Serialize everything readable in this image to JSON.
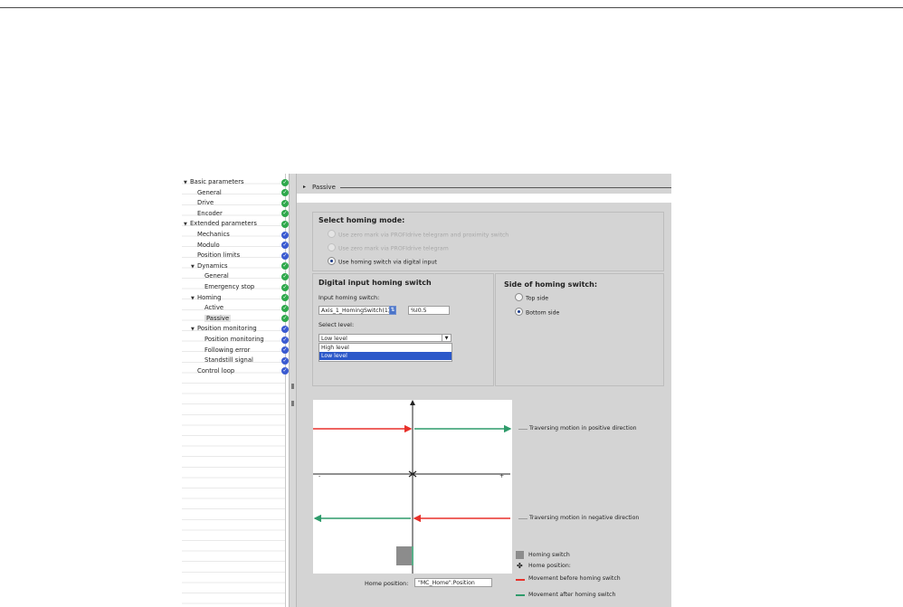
{
  "tree": [
    {
      "label": "Basic parameters",
      "expanded": true,
      "status": "green"
    },
    {
      "label": "General",
      "status": "green"
    },
    {
      "label": "Drive",
      "status": "green"
    },
    {
      "label": "Encoder",
      "status": "green"
    },
    {
      "label": "Extended parameters",
      "expanded": true,
      "status": "green"
    },
    {
      "label": "Mechanics",
      "status": "blue"
    },
    {
      "label": "Modulo",
      "status": "blue"
    },
    {
      "label": "Position limits",
      "status": "blue"
    },
    {
      "label": "Dynamics",
      "expanded": true,
      "status": "green"
    },
    {
      "label": "General",
      "status": "green"
    },
    {
      "label": "Emergency stop",
      "status": "green"
    },
    {
      "label": "Homing",
      "expanded": true,
      "status": "green"
    },
    {
      "label": "Active",
      "status": "green"
    },
    {
      "label": "Passive",
      "status": "green",
      "selected": true
    },
    {
      "label": "Position monitoring",
      "expanded": true,
      "status": "blue"
    },
    {
      "label": "Position monitoring",
      "status": "blue"
    },
    {
      "label": "Following error",
      "status": "blue"
    },
    {
      "label": "Standstill signal",
      "status": "blue"
    },
    {
      "label": "Control loop",
      "status": "blue"
    }
  ],
  "section_title": "Passive",
  "homing_mode": {
    "title": "Select homing mode:",
    "options": [
      {
        "label": "Use zero mark via PROFIdrive telegram and proximity switch",
        "enabled": false,
        "selected": false
      },
      {
        "label": "Use zero mark via PROFIdrive telegram",
        "enabled": false,
        "selected": false
      },
      {
        "label": "Use homing switch via digital input",
        "enabled": true,
        "selected": true
      }
    ]
  },
  "digital_input": {
    "title": "Digital input homing switch",
    "input_label": "Input homing switch:",
    "input_value": "Axis_1_HomingSwitch(1)",
    "address": "%I0.5",
    "level_label": "Select level:",
    "level_value": "Low level",
    "level_options": [
      "High level",
      "Low level"
    ]
  },
  "side": {
    "title": "Side of homing switch:",
    "options": [
      {
        "label": "Top side",
        "selected": false
      },
      {
        "label": "Bottom side",
        "selected": true
      }
    ]
  },
  "diagram": {
    "minus_label": "-",
    "plus_label": "+",
    "annotation_positive": "Traversing motion in positive direction",
    "annotation_negative": "Traversing motion in negative direction",
    "legend": {
      "homing_switch": "Homing switch",
      "home_position": "Home position:",
      "before": "Movement before homing switch",
      "after": "Movement after homing switch"
    },
    "colors": {
      "before": "#e8312b",
      "after": "#2f9b6b",
      "switch": "#8c8c8c"
    }
  },
  "home_position": {
    "label": "Home position:",
    "value": "\"MC_Home\".Position"
  }
}
